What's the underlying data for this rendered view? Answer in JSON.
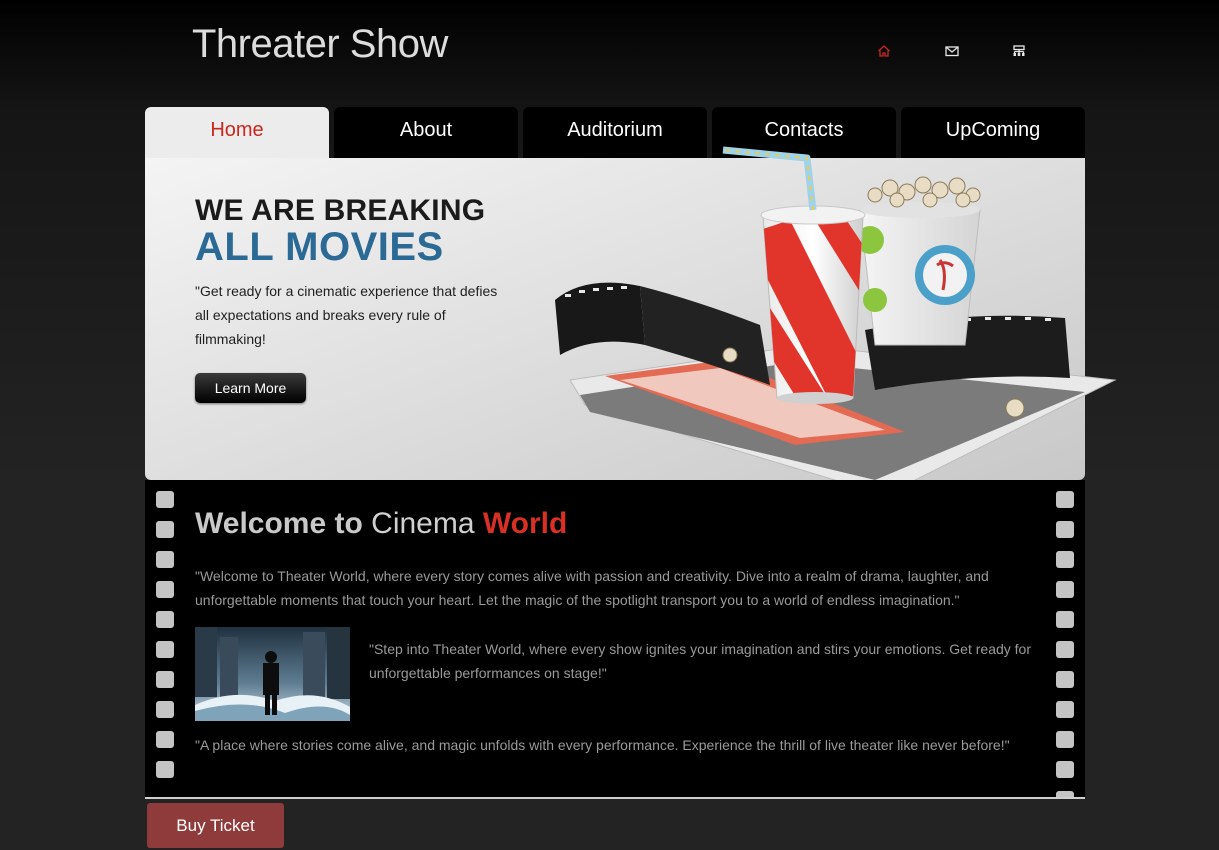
{
  "site": {
    "title": "Threater Show"
  },
  "header_icons": [
    {
      "name": "home-icon",
      "color": "#c8291f"
    },
    {
      "name": "mail-icon",
      "color": "#e6e6e6"
    },
    {
      "name": "sitemap-icon",
      "color": "#e6e6e6"
    }
  ],
  "nav": {
    "tabs": [
      {
        "label": "Home",
        "active": true
      },
      {
        "label": "About",
        "active": false
      },
      {
        "label": "Auditorium",
        "active": false
      },
      {
        "label": "Contacts",
        "active": false
      },
      {
        "label": "UpComing",
        "active": false
      }
    ]
  },
  "hero": {
    "line1": "WE ARE BREAKING",
    "line2": "ALL MOVIES",
    "text": "\"Get ready for a cinematic experience that defies all expectations and breaks every rule of filmmaking!",
    "button_label": "Learn More"
  },
  "welcome": {
    "title_part1": "Welcome to ",
    "title_part2": "Cinema ",
    "title_part3": "World",
    "p1": "\"Welcome to Theater World, where every story comes alive with passion and creativity. Dive into a realm of drama, laughter, and unforgettable moments that touch your heart. Let the magic of the spotlight transport you to a world of endless imagination.\"",
    "p2": "\"Step into Theater World, where every show ignites your imagination and stirs your emotions. Get ready for unforgettable performances on stage!\"",
    "p3": "\"A place where stories come alive, and magic unfolds with every performance. Experience the thrill of live theater like never before!\""
  },
  "footer": {
    "buy_label": "Buy Ticket"
  },
  "colors": {
    "accent_red": "#c8291f",
    "hero_blue": "#2b6a94",
    "buy_button": "#8f3b3b"
  }
}
